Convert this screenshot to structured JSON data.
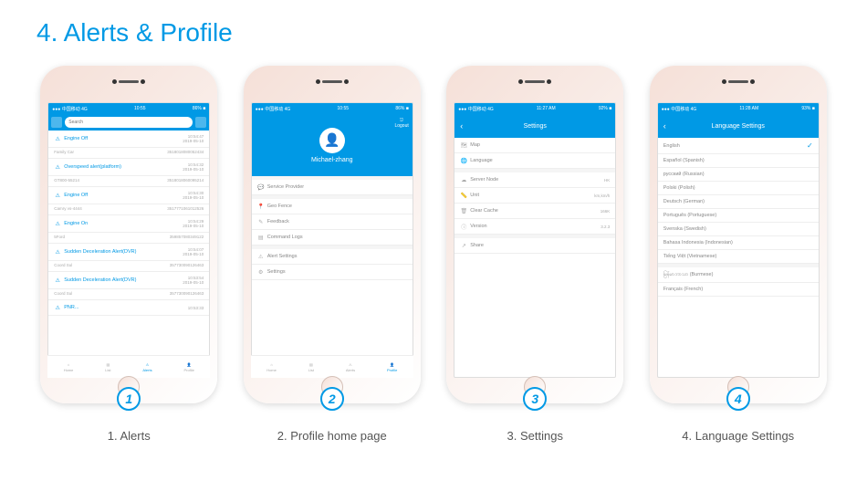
{
  "title": "4. Alerts & Profile",
  "status": {
    "left": "●●● 中国移动 4G",
    "time": "10:55",
    "right": "86% ■"
  },
  "status2": {
    "left": "●●● 中国移动 4G",
    "time": "11:27 AM",
    "right": "92% ■"
  },
  "status3": {
    "left": "●●● 中国移动 4G",
    "time": "11:28 AM",
    "right": "93% ■"
  },
  "p1": {
    "search_placeholder": "Search",
    "alerts": [
      {
        "title": "Engine Off",
        "t": "10:54:47",
        "d": "2019-05-10",
        "dev": "Family Car",
        "code": "3518018080052434"
      },
      {
        "title": "Overspeed alert(platform)",
        "t": "10:54:32",
        "d": "2019-05-10",
        "dev": "GT800-55214",
        "code": "3518018060095214"
      },
      {
        "title": "Engine Off",
        "t": "10:54:30",
        "d": "2019-05-10",
        "dev": "Camry vs-4444",
        "code": "3517771061012526"
      },
      {
        "title": "Engine On",
        "t": "10:54:29",
        "d": "2019-05-10",
        "dev": "5Ford",
        "code": "359857080349122"
      },
      {
        "title": "Sudden Deceleration Alert(DVR)",
        "t": "10:54:07",
        "d": "2019-05-10",
        "dev": "Coord Sul",
        "code": "357730090126463"
      },
      {
        "title": "Sudden Deceleration Alert(DVR)",
        "t": "10:53:54",
        "d": "2019-05-10",
        "dev": "Coord Sul",
        "code": "357730090126463"
      }
    ],
    "last_time": "10:53:33",
    "tabs": [
      "Home",
      "List",
      "Alerts",
      "Profile"
    ],
    "active_tab": 2
  },
  "p2": {
    "user": "Michael-zhang",
    "logout": "Logout",
    "items": [
      "Service Provider",
      "Geo Fence",
      "Feedback",
      "Command Logs",
      "Alert Settings",
      "Settings"
    ],
    "tabs": [
      "Home",
      "List",
      "Alerts",
      "Profile"
    ],
    "active_tab": 3
  },
  "p3": {
    "title": "Settings",
    "items": [
      {
        "l": "Map",
        "v": ""
      },
      {
        "l": "Language",
        "v": ""
      },
      {
        "l": "Server Node",
        "v": "HK"
      },
      {
        "l": "Unit",
        "v": "km,km/h"
      },
      {
        "l": "Clear Cache",
        "v": "166K"
      },
      {
        "l": "Version",
        "v": "3.2.3"
      },
      {
        "l": "Share",
        "v": ""
      }
    ]
  },
  "p4": {
    "title": "Language Settings",
    "langs": [
      "English",
      "Español (Spanish)",
      "русский (Russian)",
      "Polski (Polish)",
      "Deutsch (German)",
      "Português (Portuguese)",
      "Svenska (Swedish)",
      "Bahasa Indonesia (Indonesian)",
      "Tiếng Việt (Vietnamese)",
      "မြန်မာဘာသာ (Burmese)",
      "Français (French)"
    ],
    "selected": 0
  },
  "captions": [
    "1. Alerts",
    "2. Profile home page",
    "3. Settings",
    "4. Language Settings"
  ],
  "badges": [
    "1",
    "2",
    "3",
    "4"
  ]
}
